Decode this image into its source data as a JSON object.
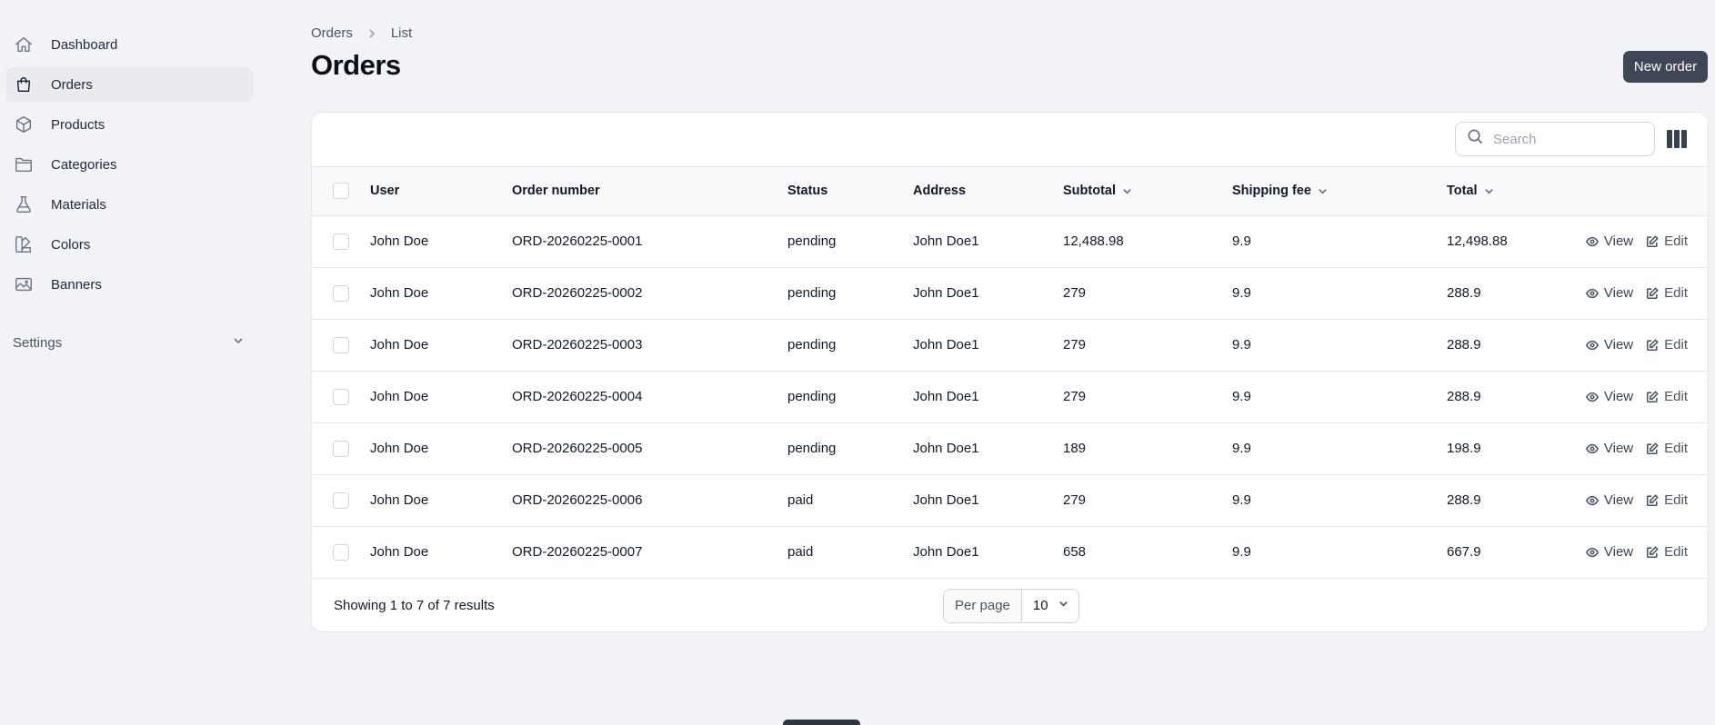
{
  "sidebar": {
    "items": [
      {
        "label": "Dashboard",
        "icon": "home-icon"
      },
      {
        "label": "Orders",
        "icon": "shopping-bag-icon",
        "active": true
      },
      {
        "label": "Products",
        "icon": "cube-icon"
      },
      {
        "label": "Categories",
        "icon": "folder-icon"
      },
      {
        "label": "Materials",
        "icon": "beaker-icon"
      },
      {
        "label": "Colors",
        "icon": "swatch-icon"
      },
      {
        "label": "Banners",
        "icon": "photo-icon"
      }
    ],
    "group": {
      "label": "Settings",
      "icon": "chevron-down-icon"
    }
  },
  "breadcrumb": {
    "root": "Orders",
    "current": "List"
  },
  "page": {
    "title": "Orders",
    "new_button": "New order"
  },
  "search": {
    "placeholder": "Search"
  },
  "table": {
    "headers": {
      "user": "User",
      "order_number": "Order number",
      "status": "Status",
      "address": "Address",
      "subtotal": "Subtotal",
      "shipping_fee": "Shipping fee",
      "total": "Total"
    },
    "action_view": "View",
    "action_edit": "Edit",
    "rows": [
      {
        "user": "John Doe",
        "order_number": "ORD-20260225-0001",
        "status": "pending",
        "address": "John Doe1",
        "subtotal": "12,488.98",
        "shipping_fee": "9.9",
        "total": "12,498.88"
      },
      {
        "user": "John Doe",
        "order_number": "ORD-20260225-0002",
        "status": "pending",
        "address": "John Doe1",
        "subtotal": "279",
        "shipping_fee": "9.9",
        "total": "288.9"
      },
      {
        "user": "John Doe",
        "order_number": "ORD-20260225-0003",
        "status": "pending",
        "address": "John Doe1",
        "subtotal": "279",
        "shipping_fee": "9.9",
        "total": "288.9"
      },
      {
        "user": "John Doe",
        "order_number": "ORD-20260225-0004",
        "status": "pending",
        "address": "John Doe1",
        "subtotal": "279",
        "shipping_fee": "9.9",
        "total": "288.9"
      },
      {
        "user": "John Doe",
        "order_number": "ORD-20260225-0005",
        "status": "pending",
        "address": "John Doe1",
        "subtotal": "189",
        "shipping_fee": "9.9",
        "total": "198.9"
      },
      {
        "user": "John Doe",
        "order_number": "ORD-20260225-0006",
        "status": "paid",
        "address": "John Doe1",
        "subtotal": "279",
        "shipping_fee": "9.9",
        "total": "288.9"
      },
      {
        "user": "John Doe",
        "order_number": "ORD-20260225-0007",
        "status": "paid",
        "address": "John Doe1",
        "subtotal": "658",
        "shipping_fee": "9.9",
        "total": "667.9"
      }
    ]
  },
  "footer": {
    "results": "Showing 1 to 7 of 7 results",
    "per_page_label": "Per page",
    "per_page_value": "10"
  },
  "colors": {
    "primary_button": "#3f4656",
    "background": "#f1f3f7",
    "active_nav": "#e9ebef"
  }
}
